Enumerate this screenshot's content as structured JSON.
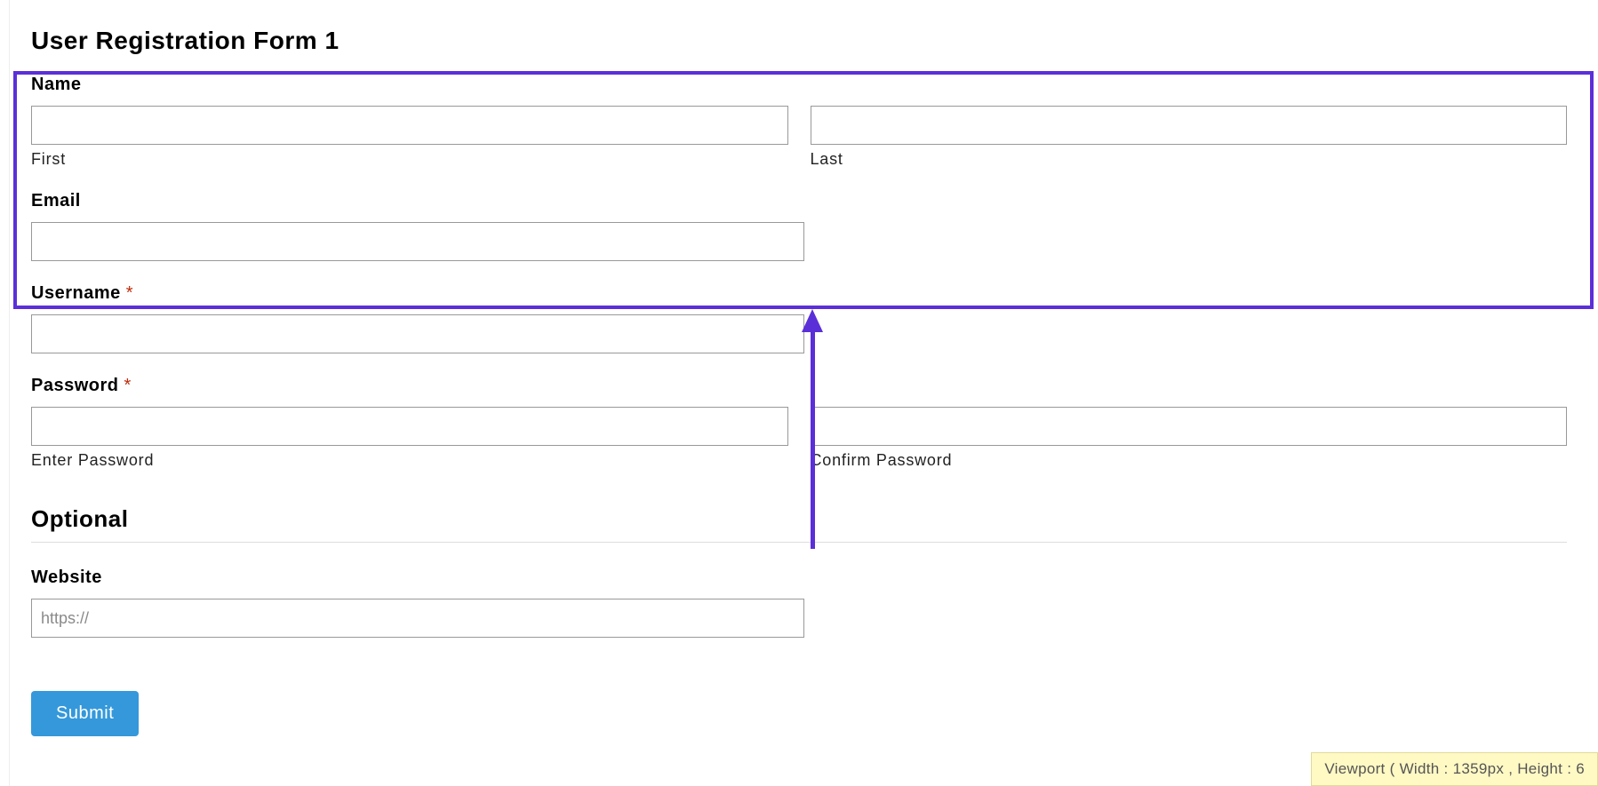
{
  "form": {
    "title": "User Registration Form 1",
    "name": {
      "label": "Name",
      "first_sub": "First",
      "last_sub": "Last",
      "first_value": "",
      "last_value": ""
    },
    "email": {
      "label": "Email",
      "value": ""
    },
    "username": {
      "label": "Username",
      "required_mark": "*",
      "value": ""
    },
    "password": {
      "label": "Password",
      "required_mark": "*",
      "enter_sub": "Enter Password",
      "confirm_sub": "Confirm Password",
      "enter_value": "",
      "confirm_value": ""
    },
    "optional_section": "Optional",
    "website": {
      "label": "Website",
      "placeholder": "https://",
      "value": ""
    },
    "submit_label": "Submit"
  },
  "viewport_badge": "Viewport ( Width : 1359px , Height : 6"
}
